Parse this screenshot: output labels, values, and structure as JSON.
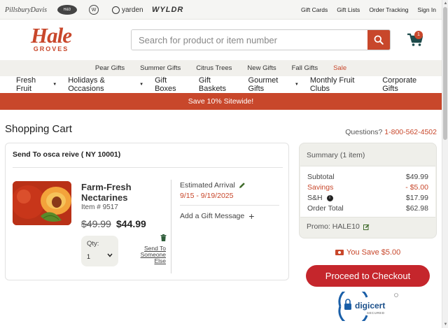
{
  "util_bar": {
    "brands": [
      "PillsburyDavis",
      "Harry & David",
      "Wolferman's",
      "yarden",
      "WYLDR"
    ],
    "links": [
      "Gift Cards",
      "Gift Lists",
      "Order Tracking",
      "Sign In"
    ]
  },
  "header": {
    "logo_main": "Hale",
    "logo_sub": "GROVES",
    "search_placeholder": "Search for product or item number",
    "cart_count": "1"
  },
  "category_bar": [
    "Pear Gifts",
    "Summer Gifts",
    "Citrus Trees",
    "New Gifts",
    "Fall Gifts",
    "Sale"
  ],
  "main_nav": [
    {
      "label": "Fresh Fruit",
      "dropdown": true
    },
    {
      "label": "Holidays & Occasions",
      "dropdown": true
    },
    {
      "label": "Gift Boxes",
      "dropdown": false
    },
    {
      "label": "Gift Baskets",
      "dropdown": false
    },
    {
      "label": "Gourmet Gifts",
      "dropdown": true
    },
    {
      "label": "Monthly Fruit Clubs",
      "dropdown": false
    },
    {
      "label": "Corporate Gifts",
      "dropdown": false
    }
  ],
  "promo_banner": "Save 10% Sitewide!",
  "cart": {
    "title": "Shopping Cart",
    "questions_label": "Questions?",
    "phone": "1-800-562-4502",
    "send_to": "Send To osca reive ( NY 10001)",
    "item": {
      "name": "Farm-Fresh Nectarines",
      "item_number": "Item # 9517",
      "price_old": "$49.99",
      "price_new": "$44.99",
      "qty_label": "Qty:",
      "qty_value": "1",
      "send_someone_else": "Send To Someone Else",
      "arrival_label": "Estimated Arrival",
      "arrival_dates": "9/15 - 9/19/2025",
      "gift_message": "Add a Gift Message"
    }
  },
  "summary": {
    "title": "Summary (1 item)",
    "subtotal_label": "Subtotal",
    "subtotal": "$49.99",
    "savings_label": "Savings",
    "savings": "- $5.00",
    "sh_label": "S&H",
    "sh": "$17.99",
    "total_label": "Order Total",
    "total": "$62.98",
    "promo": "Promo: HALE10"
  },
  "you_save": "You Save $5.00",
  "checkout_label": "Proceed to Checkout",
  "digicert": {
    "name": "digicert",
    "secured": "SECURED"
  },
  "colors": {
    "brand": "#c8472b",
    "checkout": "#c5262c",
    "band": "#f1f0ec"
  }
}
